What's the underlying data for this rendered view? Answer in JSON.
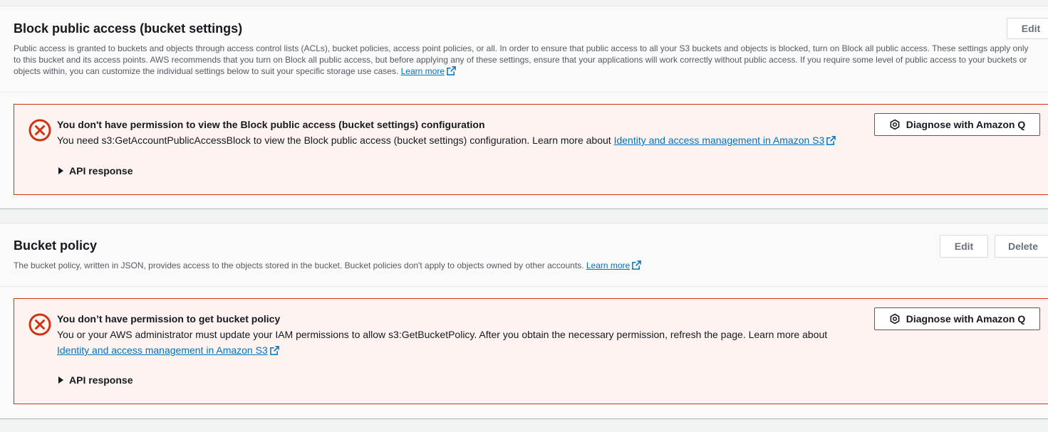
{
  "block_public_access": {
    "title": "Block public access (bucket settings)",
    "description": "Public access is granted to buckets and objects through access control lists (ACLs), bucket policies, access point policies, or all. In order to ensure that public access to all your S3 buckets and objects is blocked, turn on Block all public access. These settings apply only to this bucket and its access points. AWS recommends that you turn on Block all public access, but before applying any of these settings, ensure that your applications will work correctly without public access. If you require some level of public access to your buckets or objects within, you can customize the individual settings below to suit your specific storage use cases.",
    "learn_more": "Learn more",
    "edit_label": "Edit",
    "alert": {
      "title": "You don't have permission to view the Block public access (bucket settings) configuration",
      "body": "You need s3:GetAccountPublicAccessBlock to view the Block public access (bucket settings) configuration. Learn more about",
      "link": "Identity and access management in Amazon S3",
      "api_response": "API response",
      "diagnose_label": "Diagnose with Amazon Q"
    }
  },
  "bucket_policy": {
    "title": "Bucket policy",
    "description": "The bucket policy, written in JSON, provides access to the objects stored in the bucket. Bucket policies don't apply to objects owned by other accounts.",
    "learn_more": "Learn more",
    "edit_label": "Edit",
    "delete_label": "Delete",
    "alert": {
      "title": "You don’t have permission to get bucket policy",
      "body": "You or your AWS administrator must update your IAM permissions to allow s3:GetBucketPolicy. After you obtain the necessary permission, refresh the page. Learn more about",
      "link": "Identity and access management in Amazon S3",
      "api_response": "API response",
      "diagnose_label": "Diagnose with Amazon Q"
    }
  },
  "colors": {
    "error_red": "#d13212",
    "link_blue": "#0073bb",
    "alert_bg": "#fdf3f1"
  }
}
